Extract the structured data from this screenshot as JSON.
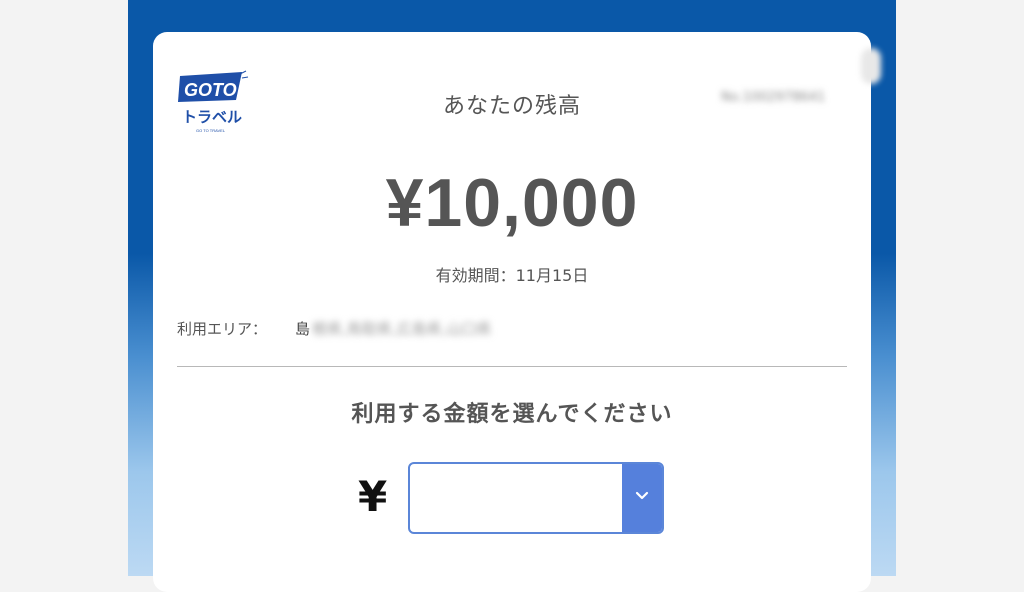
{
  "header": {
    "logo_text_top": "GOTO",
    "logo_text_bottom": "トラベル",
    "logo_tagline": "GO TO TRAVEL",
    "title": "あなたの残高",
    "account_id": "No.1002978641"
  },
  "balance": {
    "amount": "¥10,000",
    "expiry": "有効期間：11月15日"
  },
  "area": {
    "label": "利用エリア：",
    "prefix": "島",
    "value": "根県,鳥取県,広島県,山口県"
  },
  "selection": {
    "title": "利用する金額を選んでください",
    "currency_symbol": "¥",
    "selected_value": ""
  },
  "colors": {
    "frame_blue": "#0a58a8",
    "select_button": "#5580dc",
    "select_border": "#5b86d8",
    "text_gray": "#555555"
  }
}
